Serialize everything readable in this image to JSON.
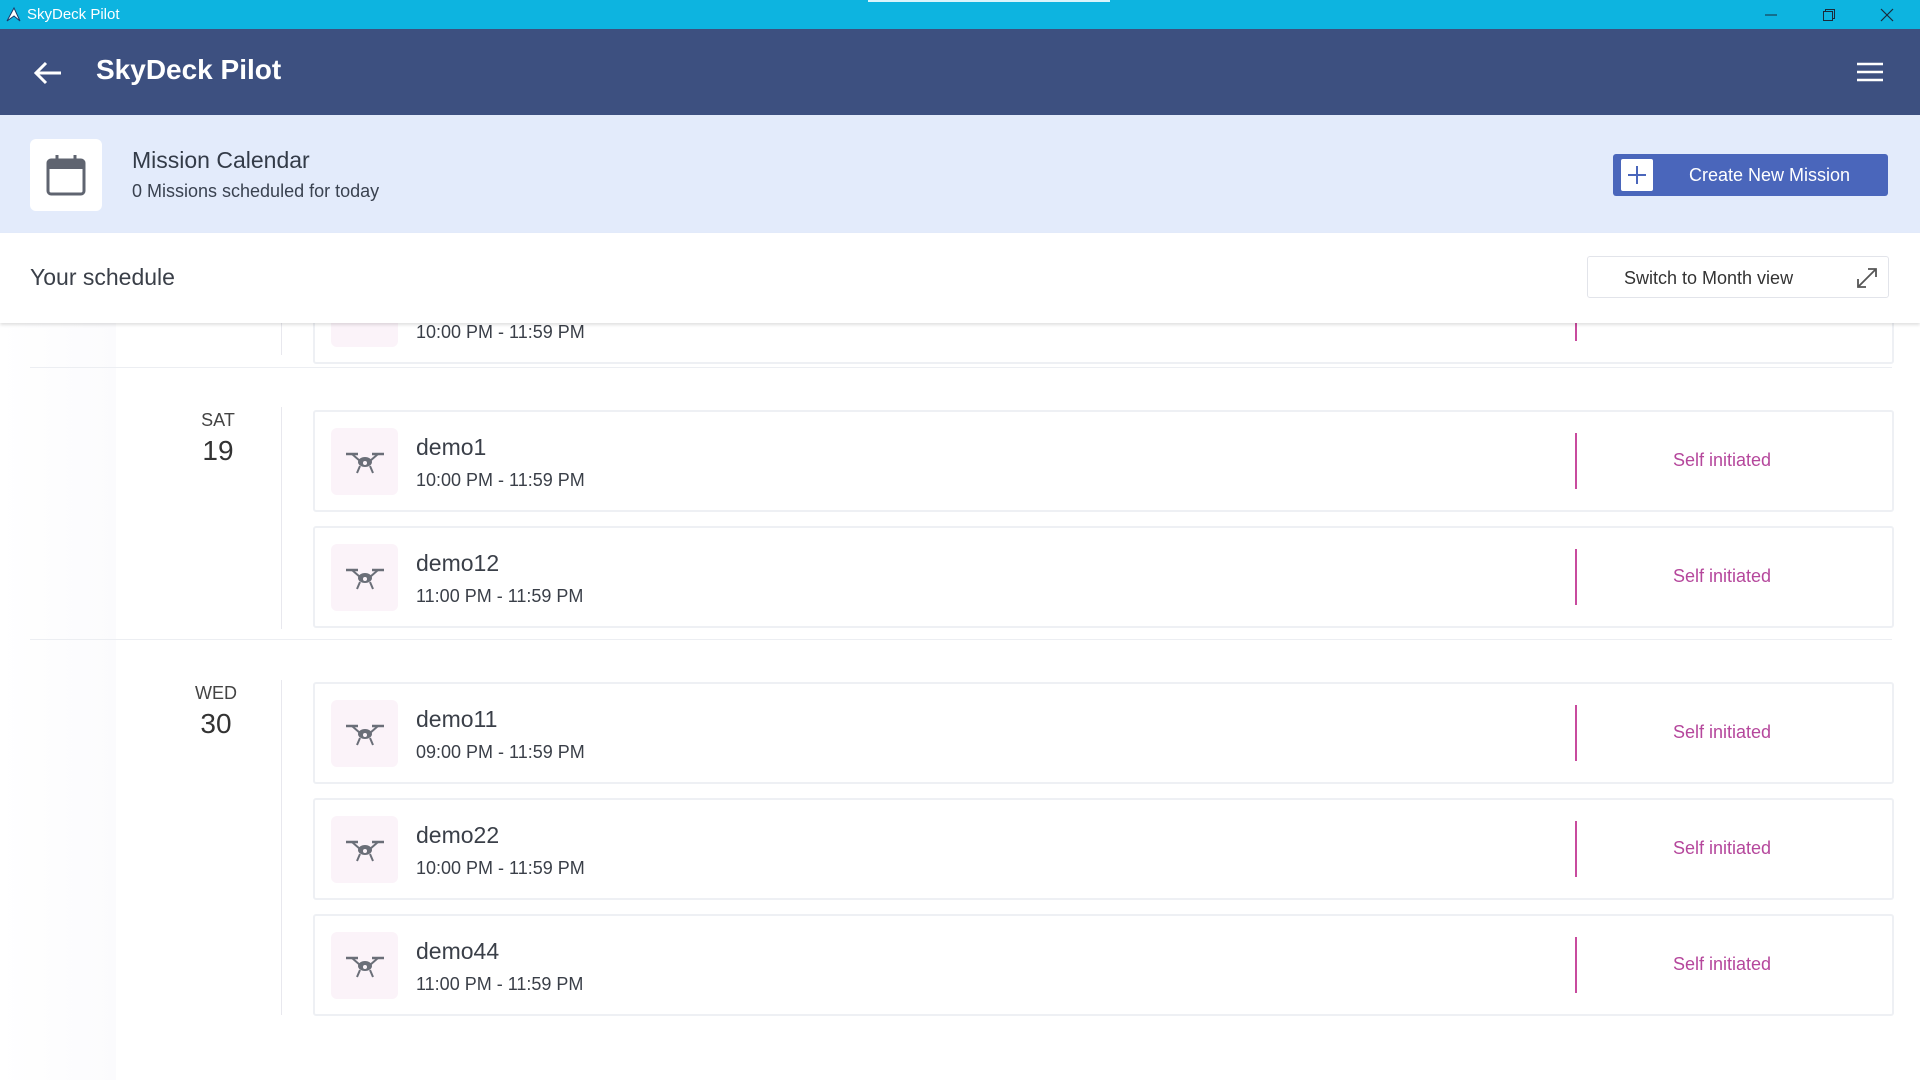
{
  "window": {
    "title": "SkyDeck Pilot",
    "accent": "#0db4e0"
  },
  "appbar": {
    "title": "SkyDeck Pilot",
    "back_icon": "arrow-left-icon",
    "menu_icon": "hamburger-menu-icon",
    "color": "#3d5080"
  },
  "calendar_header": {
    "icon": "calendar-icon",
    "title": "Mission Calendar",
    "subtitle": "0 Missions scheduled for today",
    "create_button": "Create New Mission",
    "create_icon": "plus-icon"
  },
  "schedule": {
    "title": "Your schedule",
    "month_view_button": "Switch to Month view",
    "month_view_icon": "expand-icon",
    "partial_card": {
      "time": "10:00 PM - 11:59 PM"
    },
    "days": [
      {
        "dow": "SAT",
        "day": "19",
        "missions": [
          {
            "name": "demo1",
            "time": "10:00 PM - 11:59 PM",
            "status": "Self initiated"
          },
          {
            "name": "demo12",
            "time": "11:00 PM - 11:59 PM",
            "status": "Self initiated"
          }
        ]
      },
      {
        "dow": "WED",
        "day": "30",
        "missions": [
          {
            "name": "demo11",
            "time": "09:00 PM - 11:59 PM",
            "status": "Self initiated"
          },
          {
            "name": "demo22",
            "time": "10:00 PM - 11:59 PM",
            "status": "Self initiated"
          },
          {
            "name": "demo44",
            "time": "11:00 PM - 11:59 PM",
            "status": "Self initiated"
          }
        ]
      }
    ],
    "status_color": "#b5479c"
  }
}
